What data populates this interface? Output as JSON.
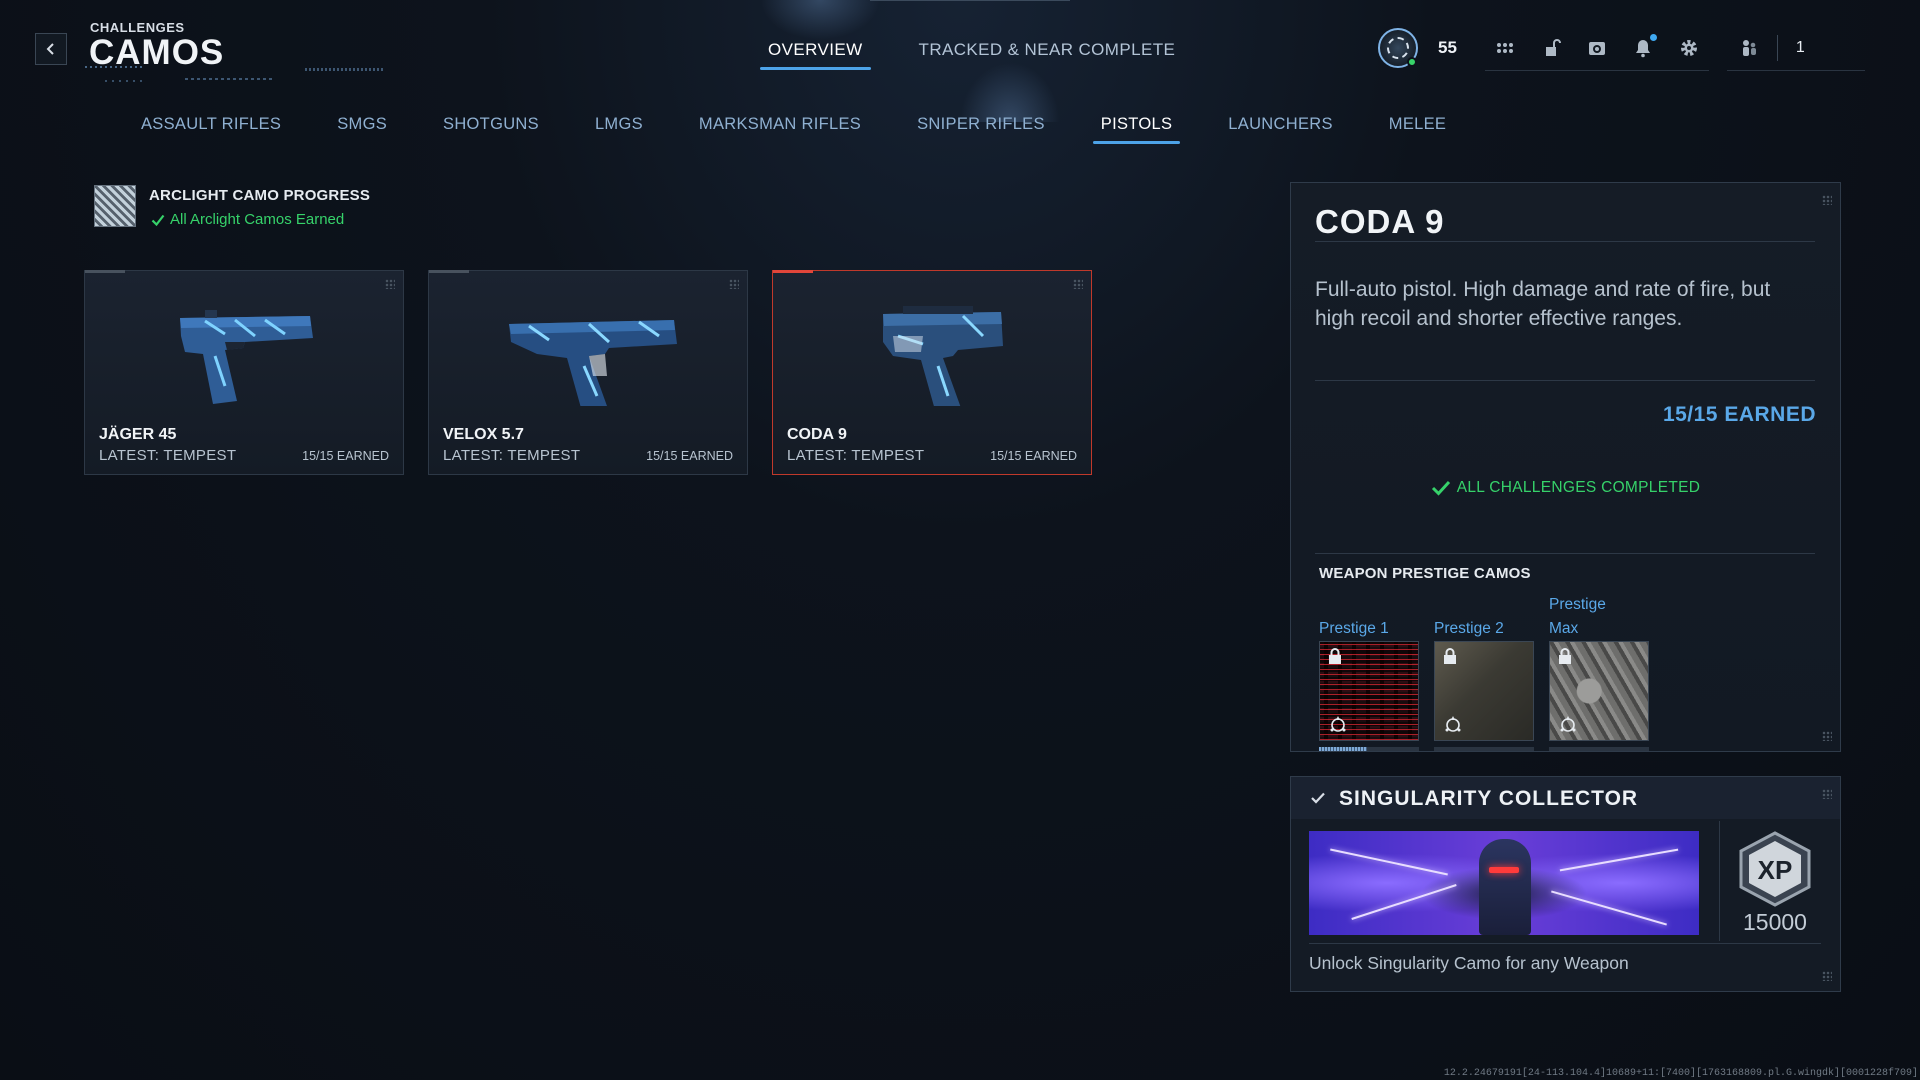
{
  "header": {
    "breadcrumb": "CHALLENGES",
    "title": "CAMOS",
    "back_icon": "chevron-left-icon"
  },
  "top_tabs": [
    {
      "label": "OVERVIEW",
      "active": true
    },
    {
      "label": "TRACKED & NEAR COMPLETE",
      "active": false
    }
  ],
  "hud": {
    "player_level": "55",
    "party_count": "1",
    "icons": [
      "level-badge-icon",
      "apps-grid-icon",
      "unlock-icon",
      "camera-icon",
      "bell-icon",
      "gear-icon",
      "party-icon"
    ]
  },
  "category_tabs": [
    {
      "label": "ASSAULT RIFLES",
      "active": false
    },
    {
      "label": "SMGS",
      "active": false
    },
    {
      "label": "SHOTGUNS",
      "active": false
    },
    {
      "label": "LMGS",
      "active": false
    },
    {
      "label": "MARKSMAN RIFLES",
      "active": false
    },
    {
      "label": "SNIPER RIFLES",
      "active": false
    },
    {
      "label": "PISTOLS",
      "active": true
    },
    {
      "label": "LAUNCHERS",
      "active": false
    },
    {
      "label": "MELEE",
      "active": false
    }
  ],
  "arclight": {
    "title": "ARCLIGHT CAMO PROGRESS",
    "status": "All Arclight Camos Earned"
  },
  "weapons": [
    {
      "name": "JÄGER 45",
      "latest": "LATEST: TEMPEST",
      "earned": "15/15 EARNED",
      "selected": false
    },
    {
      "name": "VELOX 5.7",
      "latest": "LATEST: TEMPEST",
      "earned": "15/15 EARNED",
      "selected": false
    },
    {
      "name": "CODA 9",
      "latest": "LATEST: TEMPEST",
      "earned": "15/15 EARNED",
      "selected": true
    }
  ],
  "detail": {
    "name": "CODA 9",
    "description": "Full-auto pistol. High damage and rate of fire, but high recoil and shorter effective ranges.",
    "earned": "15/15 EARNED",
    "status": "ALL CHALLENGES COMPLETED",
    "prestige_heading": "WEAPON PRESTIGE CAMOS",
    "prestige": [
      {
        "label": "Prestige 1",
        "locked": true,
        "progress": 0.48
      },
      {
        "label": "Prestige 2",
        "locked": true,
        "progress": 0
      },
      {
        "label": "Prestige Max",
        "locked": true,
        "progress": 0
      }
    ]
  },
  "singularity": {
    "title": "SINGULARITY COLLECTOR",
    "xp_label": "XP",
    "xp_amount": "15000",
    "description": "Unlock Singularity Camo for any Weapon"
  },
  "build_string": "12.2.24679191[24-113.104.4]10689+11:[7400][1763168809.pl.G.wingdk][0001228f709]",
  "colors": {
    "accent_blue": "#4da3e8",
    "success_green": "#36d26a",
    "selected_red": "#e2463a"
  }
}
